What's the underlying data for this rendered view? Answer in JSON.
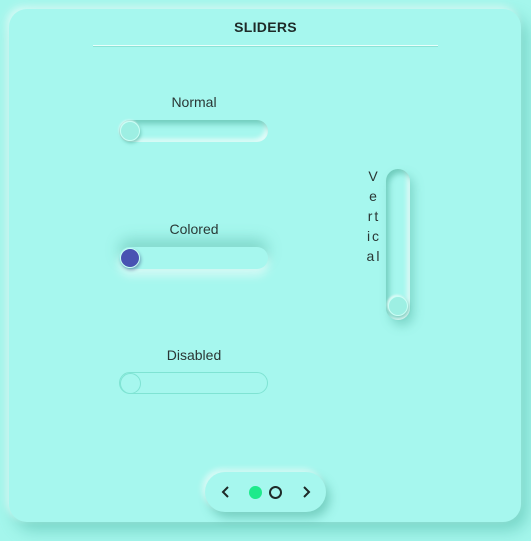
{
  "header": {
    "title": "SLIDERS"
  },
  "sliders": {
    "normal": {
      "label": "Normal",
      "value": 0
    },
    "colored": {
      "label": "Colored",
      "value": 0,
      "thumb_color": "#4852b2"
    },
    "disabled": {
      "label": "Disabled",
      "value": 0,
      "enabled": false
    },
    "vertical": {
      "label": "Vertical",
      "value": 0
    }
  },
  "pager": {
    "pages": 2,
    "current": 1,
    "active_color": "#1eea8b",
    "prev_icon": "chevron-left-icon",
    "next_icon": "chevron-right-icon"
  },
  "colors": {
    "background": "#a4f6ec",
    "text": "#1e2a28"
  }
}
